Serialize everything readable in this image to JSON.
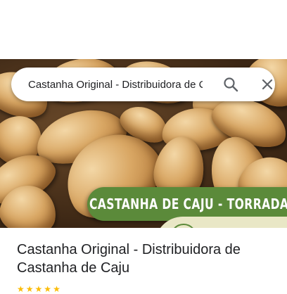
{
  "search": {
    "query": "Castanha Original - Distribuidora de Castanha de Caju",
    "search_icon": "search-icon",
    "close_icon": "close-icon"
  },
  "hero": {
    "banner_text": "CASTANHA DE CAJU - TORRADA",
    "banner_color": "#5b8a3a"
  },
  "place": {
    "title": "Castanha Original - Distribuidora de Castanha de Caju",
    "rating_icon": "star-icon"
  }
}
